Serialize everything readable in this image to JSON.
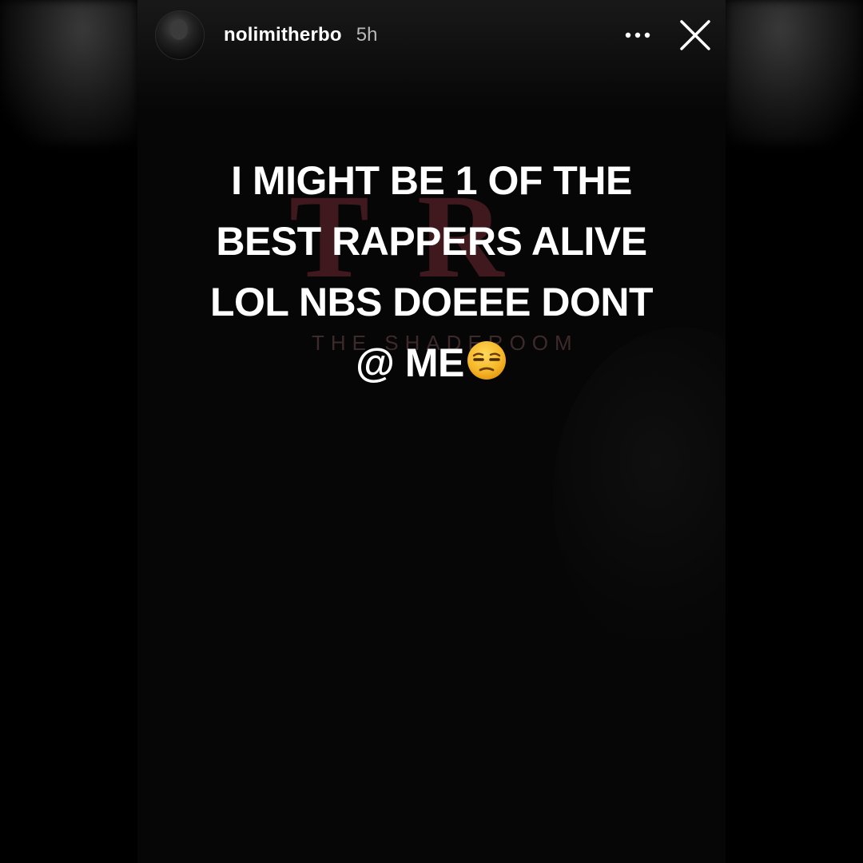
{
  "story": {
    "username": "nolimitherbo",
    "timestamp": "5h",
    "caption_lines": [
      "I MIGHT BE 1 OF THE",
      "BEST RAPPERS ALIVE",
      "LOL NBS DOEEE DONT",
      "@ ME"
    ],
    "emoji": "unamused-face",
    "watermark": {
      "letters": "TR",
      "subtitle": "THE SHADEROOM"
    }
  },
  "icons": {
    "more": "more-horizontal-icon",
    "close": "close-icon"
  },
  "colors": {
    "background": "#000000",
    "text": "#ffffff",
    "timestamp": "#b8b8b8",
    "watermark": "#4a1d22",
    "emoji_face": "#f7c23a"
  }
}
